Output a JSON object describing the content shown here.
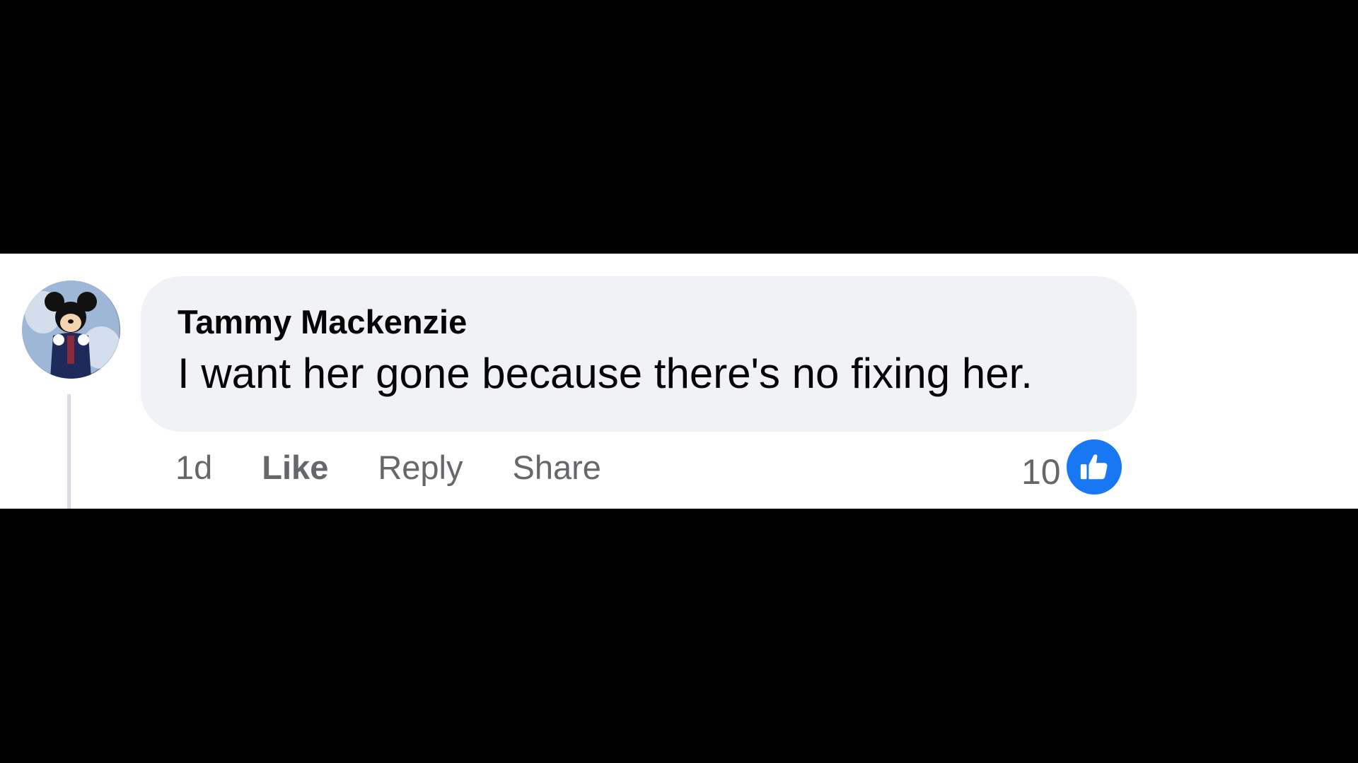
{
  "comment": {
    "author": "Tammy Mackenzie",
    "text": "I want her gone because there's no fixing her.",
    "timestamp": "1d",
    "actions": {
      "like": "Like",
      "reply": "Reply",
      "share": "Share"
    },
    "reactions": {
      "count": "10",
      "icon": "thumbs-up-icon",
      "badge_color": "#1877f2"
    },
    "avatar_icon": "profile-avatar"
  },
  "colors": {
    "bubble": "#f0f2f5",
    "text": "#050505",
    "secondary_text": "#65676b",
    "letterbox": "#000000"
  }
}
